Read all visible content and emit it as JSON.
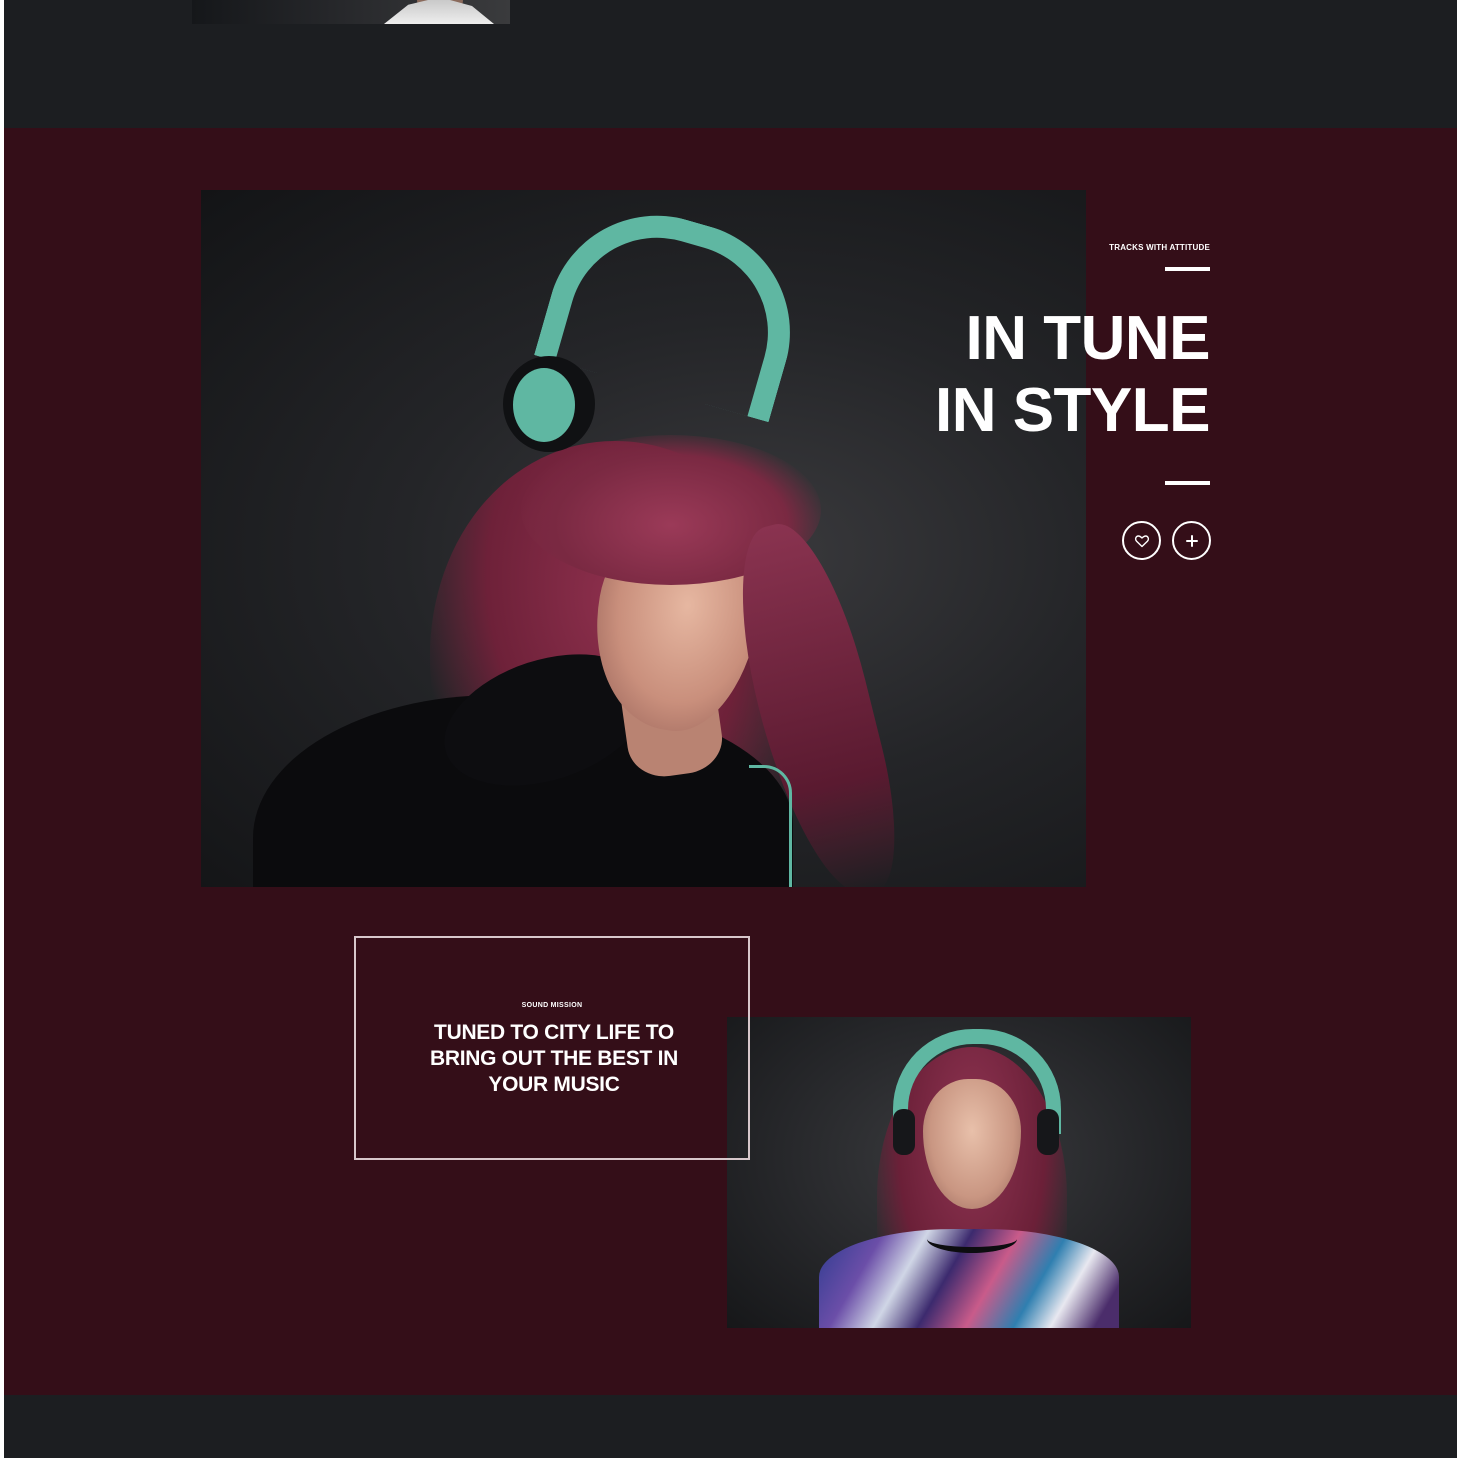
{
  "hero": {
    "eyebrow": "TRACKS WITH ATTITUDE",
    "headline_line1": "IN TUNE",
    "headline_line2": "IN STYLE",
    "actions": [
      {
        "name": "like",
        "icon": "heart-icon"
      },
      {
        "name": "add",
        "icon": "plus-icon"
      }
    ]
  },
  "mission": {
    "label": "SOUND MISSION",
    "text": "TUNED TO CITY LIFE TO BRING OUT THE BEST IN YOUR MUSIC"
  },
  "colors": {
    "page_background": "#1c1e21",
    "band_background": "#340e18",
    "accent_teal": "#5fb7a2",
    "text": "#ffffff"
  }
}
